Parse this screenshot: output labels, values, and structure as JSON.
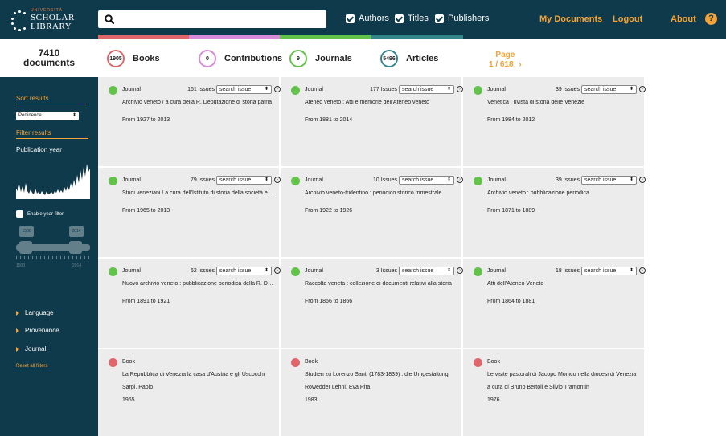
{
  "app": {
    "logo_small": "UNIVERSITÀ",
    "logo_line1": "SCHOLAR",
    "logo_line2": "LIBRARY"
  },
  "search": {
    "value": "",
    "placeholder": ""
  },
  "filters": [
    {
      "label": "Authors",
      "checked": true
    },
    {
      "label": "Titles",
      "checked": true
    },
    {
      "label": "Publishers",
      "checked": true
    }
  ],
  "nav": {
    "my_documents": "My Documents",
    "logout": "Logout",
    "about": "About",
    "help": "?"
  },
  "colors": {
    "books": "#e0666b",
    "contributions": "#d98ad8",
    "journals": "#62c24a",
    "articles": "#33878b",
    "accent": "#f2a33a",
    "dark": "#0f3a4b"
  },
  "counts": {
    "documents_number": "7410",
    "documents_label": "documents",
    "books": {
      "count": "1905",
      "label": "Books"
    },
    "contributions": {
      "count": "0",
      "label": "Contributions"
    },
    "journals": {
      "count": "9",
      "label": "Journals"
    },
    "articles": {
      "count": "5496",
      "label": "Articles"
    }
  },
  "pagination": {
    "label": "Page",
    "value": "1 / 618",
    "next": "›"
  },
  "sidebar": {
    "sort_heading": "Sort results",
    "sort_value": "Pertinence",
    "filter_heading": "Filter results",
    "pub_year": "Publication year",
    "enable_year": "Enable year filter",
    "slider_min": "1500",
    "slider_max": "2014",
    "axis_min": "1500",
    "axis_max": "2014",
    "links": [
      "Language",
      "Provenance",
      "Journal"
    ],
    "reset": "Reset all filters"
  },
  "results": [
    {
      "type": "Journal",
      "issues": "161 Issues",
      "select": "search issue",
      "title": "Archivio veneto / a cura della R. Deputazione di storia patria",
      "from": "From 1927 to 2013"
    },
    {
      "type": "Journal",
      "issues": "177 Issues",
      "select": "search issue",
      "title": "Ateneo veneto : Atti e memorie dell'Ateneo veneto",
      "from": "From 1881 to 2014"
    },
    {
      "type": "Journal",
      "issues": "39 Issues",
      "select": "search issue",
      "title": "Venetica : rivista di storia delle Venezie",
      "from": "From 1984 to 2012"
    },
    {
      "type": "Journal",
      "issues": "79 Issues",
      "select": "search issue",
      "title": "Studi veneziani / a cura dell'Istituto di storia della società e dello stato veneziano",
      "from": "From 1965 to 2013"
    },
    {
      "type": "Journal",
      "issues": "10 Issues",
      "select": "search issue",
      "title": "Archivio veneto-tridentino : periodico storico trimestrale",
      "from": "From 1922 to 1926"
    },
    {
      "type": "Journal",
      "issues": "39 Issues",
      "select": "search issue",
      "title": "Archivio veneto : pubblicazione periodica",
      "from": "From 1871 to 1889"
    },
    {
      "type": "Journal",
      "issues": "62 Issues",
      "select": "search issue",
      "title": "Nuovo archivio veneto : pubblicazione periodica della R. Deputazione",
      "from": "From 1891 to 1921"
    },
    {
      "type": "Journal",
      "issues": "3 Issues",
      "select": "search issue",
      "title": "Raccolta veneta : collezione di documenti relativi alla storia",
      "from": "From 1866 to 1866"
    },
    {
      "type": "Journal",
      "issues": "18 Issues",
      "select": "search issue",
      "title": "Atti dell'Ateneo Veneto",
      "from": "From 1864 to 1881"
    },
    {
      "type": "Book",
      "title": "La Repubblica di Venezia la casa d'Austria e gli Uscocchi",
      "author": "Sarpi, Paolo",
      "year": "1965"
    },
    {
      "type": "Book",
      "title": "Studien zu Lorenzo Santi (1783-1839) : die Umgestaltung",
      "author": "Rowedder Lehni, Eva Rita",
      "year": "1983"
    },
    {
      "type": "Book",
      "title": "Le visite pastorali di Jacopo Monico nella diocesi di Venezia",
      "author": "a cura di Bruno Bertoli e Silvio Tramontin",
      "year": "1976"
    }
  ]
}
